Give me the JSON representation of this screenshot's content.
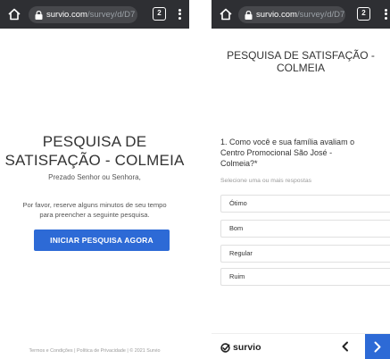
{
  "left_screen": {
    "browser": {
      "url_host": "survio.com",
      "url_path": "/survey/d/D7",
      "tab_count": "2"
    },
    "title_line1": "PESQUISA DE",
    "title_line2": "SATISFAÇÃO - COLMEIA",
    "greeting": "Prezado Senhor ou Senhora,",
    "intro_line1": "Por favor, reserve alguns minutos de seu tempo",
    "intro_line2": "para preencher a seguinte pesquisa.",
    "start_button": "INICIAR PESQUISA AGORA",
    "footer": {
      "terms": "Termos e Condições",
      "separator": "|",
      "privacy": "Política de Privacidade",
      "copyright": "© 2021 Survio"
    }
  },
  "right_screen": {
    "browser": {
      "url_host": "survio.com",
      "url_path": "/survey/d/D7",
      "tab_count": "2"
    },
    "title_line1": "PESQUISA DE SATISFAÇÃO -",
    "title_line2": "COLMEIA",
    "question_line1": "1. Como você e sua família avaliam o",
    "question_line2": "Centro Promocional São José -",
    "question_line3": "Colmeia?*",
    "hint": "Selecione uma ou mais respostas",
    "options": [
      "Ótimo",
      "Bom",
      "Regular",
      "Ruim"
    ],
    "brand": "survio"
  },
  "colors": {
    "accent_blue": "#2d6ad6",
    "chrome_bar": "#2e2f33",
    "text_dark": "#333333"
  },
  "icons": {
    "home": "home-icon",
    "lock": "lock-icon",
    "menu": "kebab-menu-icon",
    "prev": "chevron-left-icon",
    "next": "chevron-right-icon"
  }
}
